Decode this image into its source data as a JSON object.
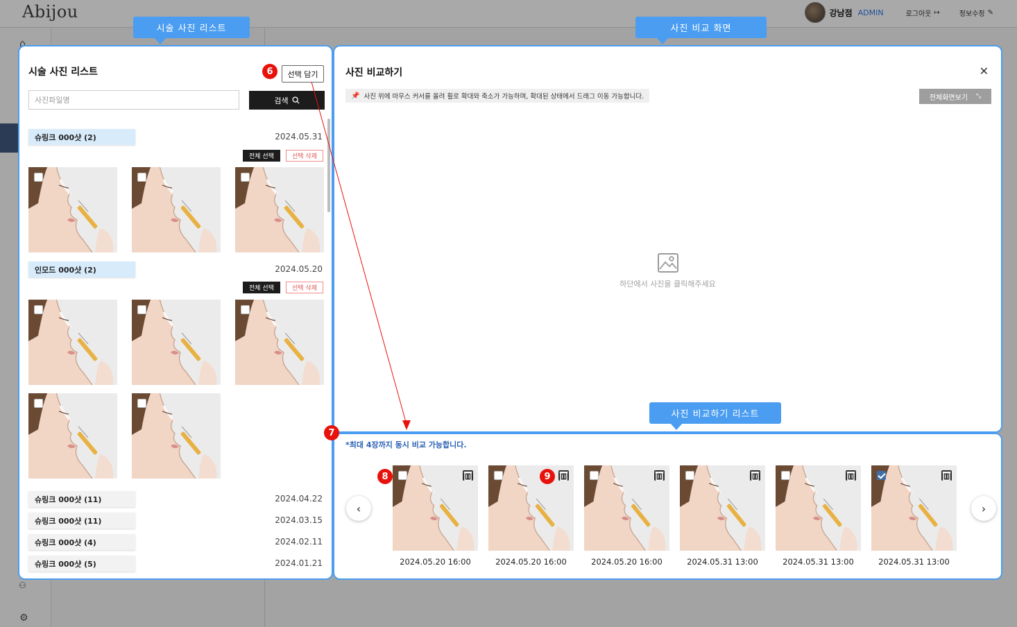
{
  "app": {
    "logo": "Abijou",
    "branch": "강남점",
    "role": "ADMIN",
    "logout": "로그아웃",
    "edit_info": "정보수정"
  },
  "callouts": {
    "left": "시술 사진 리스트",
    "compare": "사진 비교 화면",
    "list": "사진 비교하기 리스트"
  },
  "markers": [
    "6",
    "7",
    "8",
    "9"
  ],
  "photo_list": {
    "title": "시술 사진 리스트",
    "pick_button": "선택 담기",
    "search_placeholder": "사진파일명",
    "search_button": "검색",
    "select_all": "전체 선택",
    "delete_selected": "선택 삭제",
    "groups": [
      {
        "name": "슈링크 000샷  (2)",
        "date": "2024.05.31",
        "photo_count": 3
      },
      {
        "name": "인모드 000샷  (2)",
        "date": "2024.05.20",
        "photo_count": 5
      }
    ],
    "collapsed_groups": [
      {
        "name": "슈링크 000샷  (11)",
        "date": "2024.04.22"
      },
      {
        "name": "슈링크 000샷  (11)",
        "date": "2024.03.15"
      },
      {
        "name": "슈링크 000샷  (4)",
        "date": "2024.02.11"
      },
      {
        "name": "슈링크 000샷  (5)",
        "date": "2024.01.21"
      }
    ]
  },
  "compare": {
    "title": "사진 비교하기",
    "hint": "사진 위에 마우스 커서를 올려 휠로 확대와 축소가 가능하며, 확대된 상태에서 드래그 이동 가능합니다.",
    "fullscreen": "전체화면보기",
    "empty": "하단에서 사진을 클릭해주세요"
  },
  "compare_list": {
    "note": "*최대 4장까지 동시 비교 가능합니다.",
    "items": [
      {
        "date": "2024.05.20 16:00",
        "checked": false
      },
      {
        "date": "2024.05.20 16:00",
        "checked": false
      },
      {
        "date": "2024.05.20 16:00",
        "checked": false
      },
      {
        "date": "2024.05.31 13:00",
        "checked": false
      },
      {
        "date": "2024.05.31 13:00",
        "checked": false
      },
      {
        "date": "2024.05.31 13:00",
        "checked": true
      }
    ]
  },
  "icons": {
    "close": "close-icon",
    "search": "search-icon",
    "prev": "chevron-left-icon",
    "next": "chevron-right-icon",
    "trash": "trash-icon",
    "image": "image-icon",
    "pin": "pin-icon",
    "expand": "expand-icon"
  },
  "colors": {
    "accent": "#4a9df0",
    "marker": "#e8120c",
    "note": "#2c61b4",
    "delete": "#e45454"
  }
}
